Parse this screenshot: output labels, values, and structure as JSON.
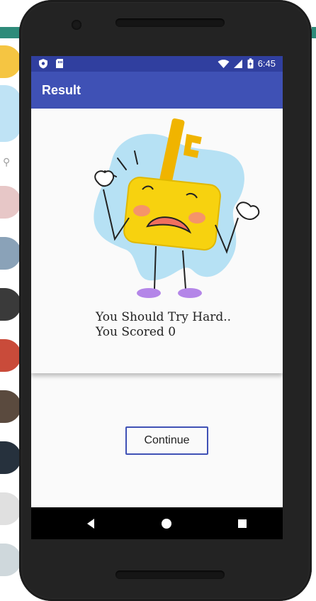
{
  "status_bar": {
    "time": "6:45",
    "icons": [
      "shield-icon",
      "sim-card-icon",
      "wifi-icon",
      "signal-icon",
      "battery-icon"
    ]
  },
  "app_bar": {
    "title": "Result"
  },
  "result": {
    "line1": "You Should Try Hard..",
    "line2": "You Scored 0"
  },
  "continue_button": {
    "label": "Continue"
  },
  "nav_bar": {
    "buttons": [
      "back-icon",
      "home-icon",
      "recents-icon"
    ]
  },
  "colors": {
    "primary": "#3f51b5",
    "primary_dark": "#303f9f",
    "key_yellow": "#f7d20f",
    "blob_blue": "#a9dcf2"
  }
}
